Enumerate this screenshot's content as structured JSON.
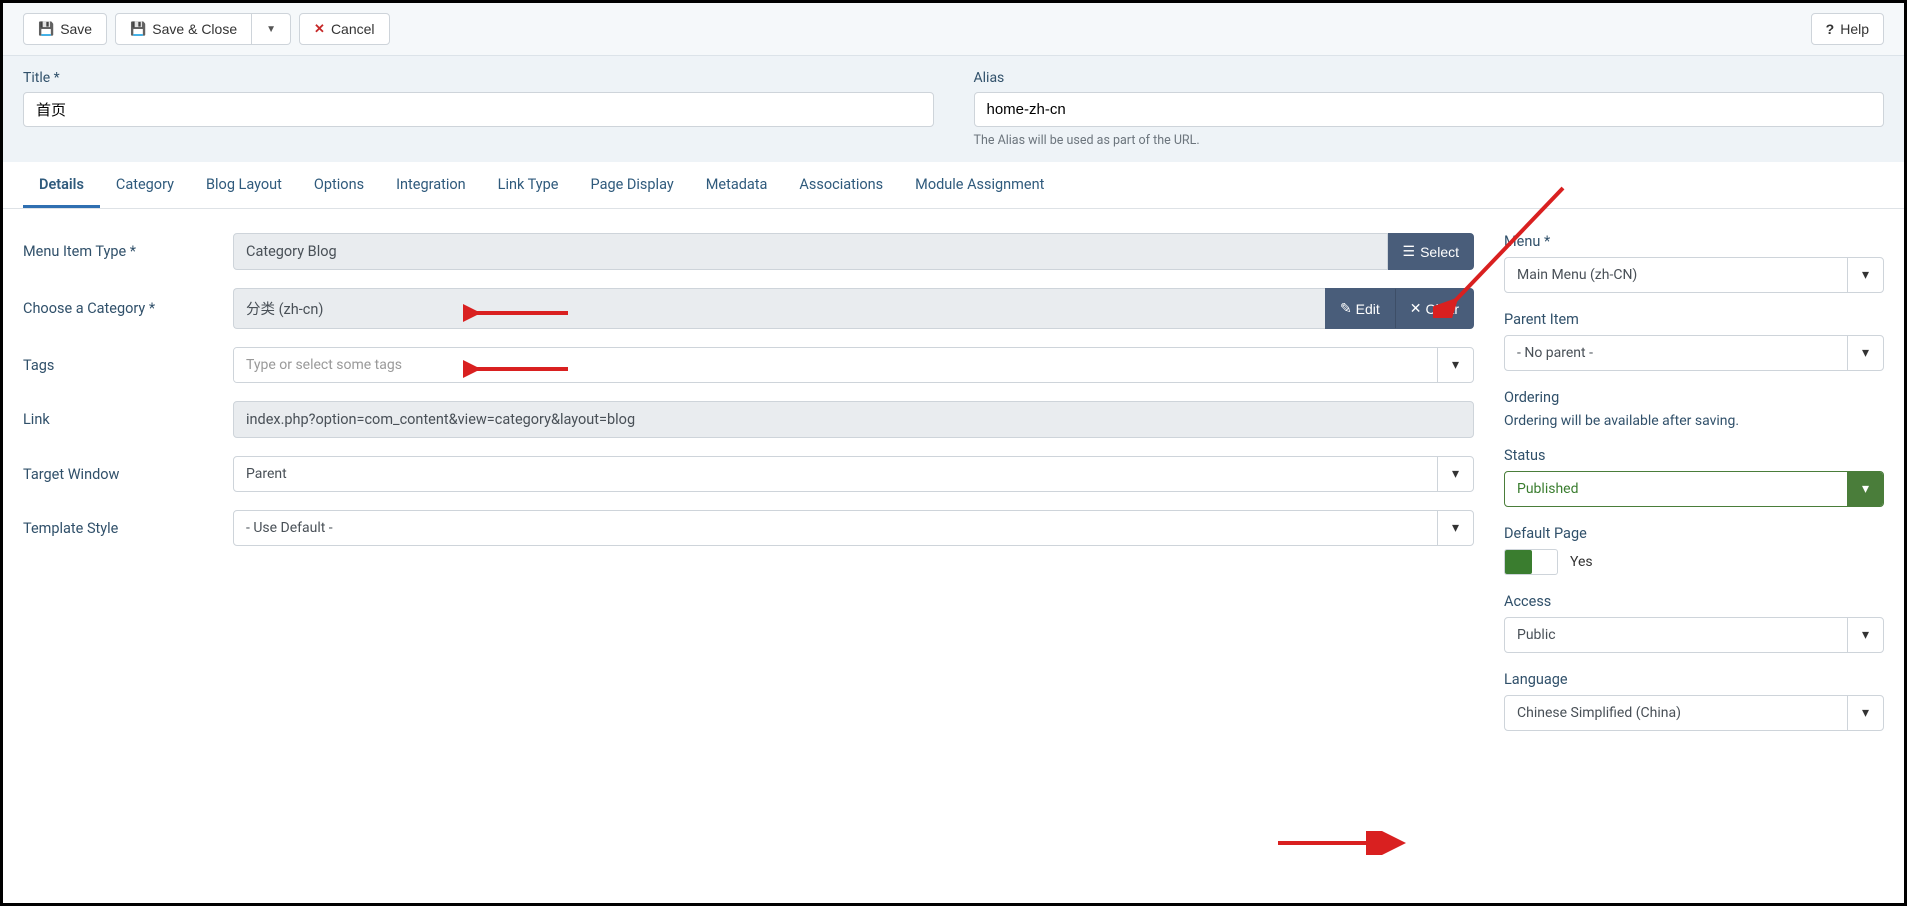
{
  "toolbar": {
    "save": "Save",
    "save_close": "Save & Close",
    "cancel": "Cancel",
    "help": "Help"
  },
  "header": {
    "title_label": "Title *",
    "title_value": "首页",
    "alias_label": "Alias",
    "alias_value": "home-zh-cn",
    "alias_help": "The Alias will be used as part of the URL."
  },
  "tabs": [
    "Details",
    "Category",
    "Blog Layout",
    "Options",
    "Integration",
    "Link Type",
    "Page Display",
    "Metadata",
    "Associations",
    "Module Assignment"
  ],
  "details": {
    "menu_item_type_label": "Menu Item Type *",
    "menu_item_type_value": "Category Blog",
    "select_btn": "Select",
    "choose_category_label": "Choose a Category *",
    "choose_category_value": "分类 (zh-cn)",
    "edit_btn": "Edit",
    "clear_btn": "Clear",
    "tags_label": "Tags",
    "tags_placeholder": "Type or select some tags",
    "link_label": "Link",
    "link_value": "index.php?option=com_content&view=category&layout=blog",
    "target_window_label": "Target Window",
    "target_window_value": "Parent",
    "template_style_label": "Template Style",
    "template_style_value": "- Use Default -"
  },
  "sidebar": {
    "menu_label": "Menu *",
    "menu_value": "Main Menu (zh-CN)",
    "parent_label": "Parent Item",
    "parent_value": "- No parent -",
    "ordering_label": "Ordering",
    "ordering_text": "Ordering will be available after saving.",
    "status_label": "Status",
    "status_value": "Published",
    "default_page_label": "Default Page",
    "default_page_value": "Yes",
    "access_label": "Access",
    "access_value": "Public",
    "language_label": "Language",
    "language_value": "Chinese Simplified (China)"
  }
}
